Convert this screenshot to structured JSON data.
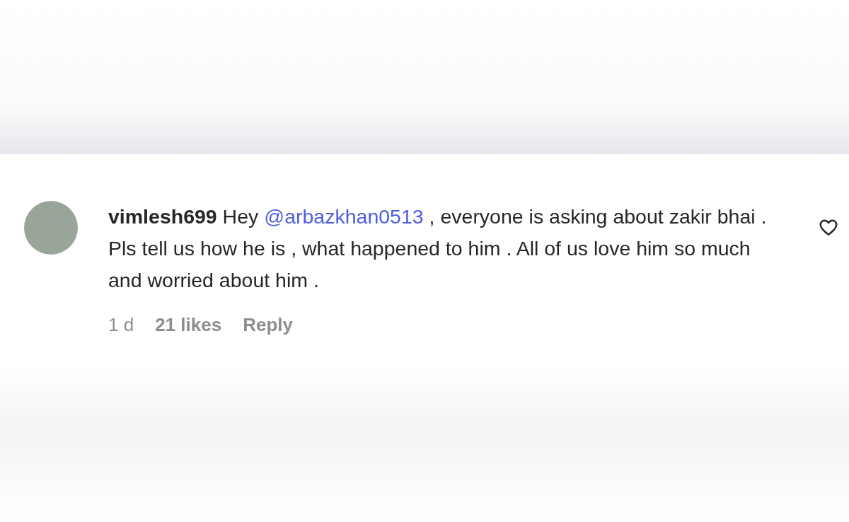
{
  "comment": {
    "username": "vimlesh699",
    "text_before": "Hey ",
    "mention": "@arbazkhan0513",
    "text_after": " , everyone is asking about zakir bhai . Pls tell us how he is , what happened to him . All of us love him so much and worried about him .",
    "liked": false,
    "time": "1 d",
    "likes": "21 likes",
    "reply": "Reply"
  }
}
